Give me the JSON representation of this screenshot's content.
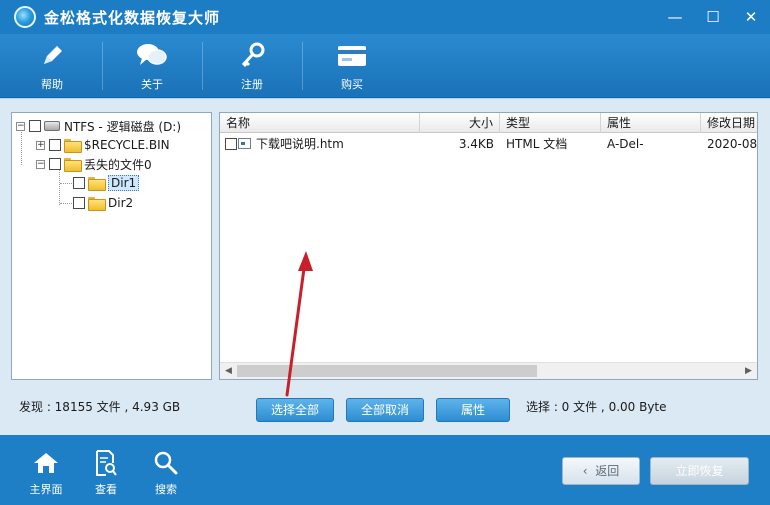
{
  "window": {
    "title": "金松格式化数据恢复大师",
    "controls": {
      "minimize": "—",
      "maximize": "☐",
      "close": "✕"
    }
  },
  "toolbar": {
    "items": [
      {
        "label": "帮助",
        "icon": "pencil-icon"
      },
      {
        "label": "关于",
        "icon": "speech-bubble-icon"
      },
      {
        "label": "注册",
        "icon": "key-icon"
      },
      {
        "label": "购买",
        "icon": "card-icon"
      }
    ]
  },
  "tree": {
    "root": "NTFS - 逻辑磁盘 (D:)",
    "nodes": [
      {
        "label": "$RECYCLE.BIN",
        "expander": "+"
      },
      {
        "label": "丢失的文件0",
        "expander": "−"
      },
      {
        "label": "Dir1",
        "selected": true
      },
      {
        "label": "Dir2"
      }
    ]
  },
  "list": {
    "columns": [
      "名称",
      "大小",
      "类型",
      "属性",
      "修改日期"
    ],
    "rows": [
      {
        "name": "下载吧说明.htm",
        "size": "3.4KB",
        "type": "HTML 文档",
        "attr": "A-Del-",
        "date": "2020-08-"
      }
    ]
  },
  "status": {
    "found": "发现 : 18155 文件 , 4.93 GB",
    "selected": "选择 : 0 文件 , 0.00 Byte"
  },
  "actions": {
    "select_all": "选择全部",
    "deselect_all": "全部取消",
    "properties": "属性"
  },
  "bottom": {
    "nav": [
      {
        "label": "主界面",
        "icon": "home-icon"
      },
      {
        "label": "查看",
        "icon": "document-search-icon"
      },
      {
        "label": "搜索",
        "icon": "magnifier-icon"
      }
    ],
    "back": "返回",
    "recover": "立即恢复"
  },
  "colors": {
    "titlebar": "#1c7cc4",
    "toolbar": "#1a72b8",
    "workarea": "#dbe9f5",
    "annotation_arrow": "#c8202a"
  }
}
